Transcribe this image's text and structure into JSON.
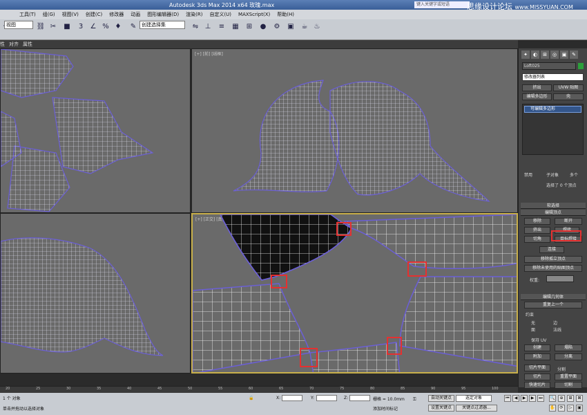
{
  "titlebar": {
    "app_title": "Autodesk 3ds Max  2014 x64   玫瑰.max",
    "search_placeholder": "键入关键字或短语",
    "watermark_cn": "思缘设计论坛",
    "watermark_url": "www.MISSYUAN.COM"
  },
  "menubar": {
    "items": [
      "工具(T)",
      "组(G)",
      "视图(V)",
      "创建(C)",
      "修改器",
      "动画",
      "图形编辑器(D)",
      "渲染(R)",
      "自定义(U)",
      "MAXScript(X)",
      "帮助(H)"
    ]
  },
  "toolbar": {
    "view_dropdown": "视图",
    "selection_set_dropdown": "创建选择集",
    "icons": [
      "undo-icon",
      "redo-icon",
      "link-icon",
      "select-icon",
      "move-icon",
      "rotate-icon",
      "scale-icon",
      "snap-icon",
      "angle-snap-icon",
      "percent-snap-icon",
      "mirror-icon",
      "align-icon",
      "layer-icon",
      "graph-icon",
      "material-icon",
      "render-setup-icon",
      "render-icon",
      "teapot-icon"
    ]
  },
  "ribbon2": {
    "items": [
      "性",
      "对齐",
      "属性"
    ]
  },
  "viewports": {
    "top_left": "",
    "top_right": "[+] [前] [线框]",
    "bottom_left": "",
    "bottom_right": "[+] [正交] [真实]"
  },
  "command_panel": {
    "tabs": [
      "create-icon",
      "modify-icon",
      "hierarchy-icon",
      "motion-icon",
      "display-icon",
      "utilities-icon"
    ],
    "object_name": "Loft025",
    "object_color": "#2c9f3a",
    "modifier_list": "修改器列表",
    "btn_extrude": "挤出",
    "btn_uvw": "UVW 贴图",
    "btn_edit_poly": "编辑多边形",
    "btn_shell": "壳",
    "stack_item": "可编辑多边形",
    "selection_none": "禁用",
    "selection_by": "子对象",
    "selection_multi": "多个",
    "selection_text": "选择了 0 个顶点",
    "soft_selection": "软选择",
    "edit_vertices": "编辑顶点",
    "btn_remove": "移除",
    "btn_break": "断开",
    "btn_extrude_v": "挤出",
    "btn_weld": "焊接",
    "btn_chamfer": "切角",
    "btn_target_weld": "目标焊接",
    "btn_connect": "连接",
    "btn_remove_isolated": "移除孤立顶点",
    "btn_remove_unused": "移除未使用的贴图顶点",
    "weight_label": "权重:",
    "edit_geometry": "编辑几何体",
    "btn_repeat_last": "重复上一个",
    "constraints": "约束",
    "c_none": "无",
    "c_edge": "边",
    "c_face": "面",
    "c_normal": "法线",
    "preserve_uv": "保持 UV",
    "btn_create": "创建",
    "btn_collapse": "塌陷",
    "btn_attach": "附加",
    "btn_detach": "分离",
    "btn_slice_plane": "切片平面",
    "btn_split": "分割",
    "btn_slice": "切片",
    "btn_reset_plane": "重置平面",
    "btn_quickslice": "快速切片",
    "btn_cut": "切割"
  },
  "timeline": {
    "ticks": [
      "20",
      "25",
      "30",
      "35",
      "40",
      "45",
      "50",
      "55",
      "60",
      "65",
      "70",
      "75",
      "80",
      "85",
      "90",
      "95",
      "100"
    ]
  },
  "status": {
    "selected": "1 个 对象",
    "prompt": "单击并拖动以选择对象",
    "x_label": "X:",
    "y_label": "Y:",
    "z_label": "Z:",
    "grid": "栅格 = 10.0mm",
    "add_time_tag": "添加时间标记",
    "auto_key": "自动关键点",
    "set_key": "设置关键点",
    "selected_dropdown": "选定对象",
    "key_filters": "关键点过滤器..."
  }
}
